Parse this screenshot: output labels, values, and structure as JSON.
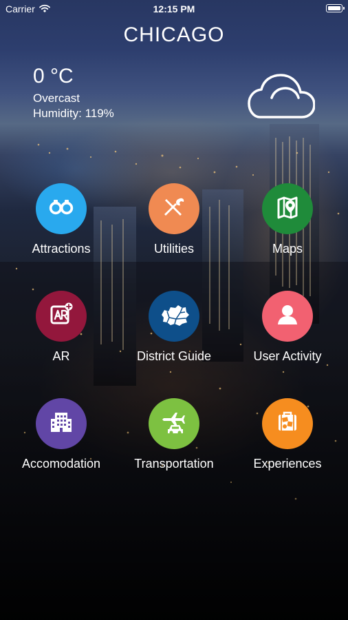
{
  "status_bar": {
    "carrier": "Carrier",
    "time": "12:15 PM"
  },
  "header": {
    "city": "CHICAGO"
  },
  "weather": {
    "temperature": "0 °C",
    "condition": "Overcast",
    "humidity": "Humidity: 119%",
    "icon": "cloud-icon"
  },
  "menu": {
    "items": [
      {
        "label": "Attractions",
        "icon": "binoculars-icon",
        "color": "#29a9ee"
      },
      {
        "label": "Utilities",
        "icon": "tools-icon",
        "color": "#f08a52"
      },
      {
        "label": "Maps",
        "icon": "map-icon",
        "color": "#1f8b3a"
      },
      {
        "label": "AR",
        "icon": "ar-icon",
        "color": "#93173c"
      },
      {
        "label": "District Guide",
        "icon": "district-map-icon",
        "color": "#0e4f8a"
      },
      {
        "label": "User Activity",
        "icon": "user-icon",
        "color": "#f26171"
      },
      {
        "label": "Accomodation",
        "icon": "building-icon",
        "color": "#6146a6"
      },
      {
        "label": "Transportation",
        "icon": "transport-icon",
        "color": "#7dc141"
      },
      {
        "label": "Experiences",
        "icon": "luggage-icon",
        "color": "#f68d1f"
      }
    ]
  }
}
